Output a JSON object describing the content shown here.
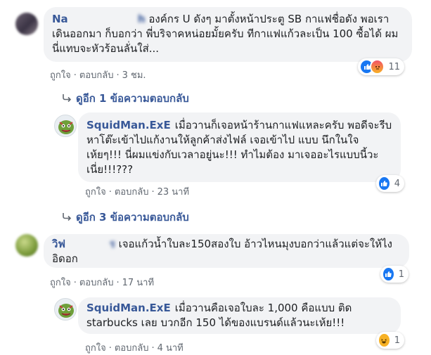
{
  "actions": {
    "like": "ถูกใจ",
    "reply": "ตอบกลับ",
    "separator": "·"
  },
  "comments": [
    {
      "author": "Na",
      "author_blurred": "                   h",
      "text": "องค์กร U ดังๆ มาตั้งหน้าประตู SB กาแฟชื่อดัง พอเราเดินออกมา ก็บอกว่า พี่บริจาคหน่อยมั้ยครับ ทีกาแฟแก้วละเป็น 100 ซื้อได้ ผมนี่แทบจะหัวร้อนลั่นใส่...",
      "time": "3 ชม.",
      "reactions_count": "11"
    },
    {
      "author": "SquidMan.ExE",
      "text": "เมื่อวานก็เจอหน้าร้านกาแฟแหละครับ พอดีจะรีบหาโต๊ะเข้าไปแก้งานให้ลูกค้าส่งไฟล์ เจอเข้าไป แบบ นึกในใจ เห้ยๆ!!! นี่ผมแข่งกับเวลาอยู่นะ!!! ทำไมต้อง มาเจออะไรแบบนี้วะเนี่ย!!!???",
      "time": "23 นาที",
      "reactions_count": "4"
    },
    {
      "author": "วิฟ",
      "author_blurred": "            ร",
      "text": "เจอแก้วน้ำใบละ150สองใบ อ้าวไหนมุงบอกว่าแล้วแต่จะให้ไง อิดอก",
      "time": "17 นาที",
      "reactions_count": "1"
    },
    {
      "author": "SquidMan.ExE",
      "text": "เมื่อวานคือเจอใบละ 1,000 คือแบบ ติด starbucks เลย บวกอีก 150 ได้ของแบรนด์แล้วนะเห้ย!!!",
      "time": "4 นาที",
      "reactions_count": "1"
    }
  ],
  "reply_links": {
    "first": "ดูอีก 1 ข้อความตอบกลับ",
    "second": "ดูอีก 3 ข้อความตอบกลับ"
  },
  "colors": {
    "link": "#385898",
    "bubble": "#f2f3f5",
    "like": "#1877f2"
  },
  "icons": [
    "reply-arrow-icon",
    "like-reaction-icon",
    "angry-reaction-icon",
    "haha-reaction-icon"
  ]
}
